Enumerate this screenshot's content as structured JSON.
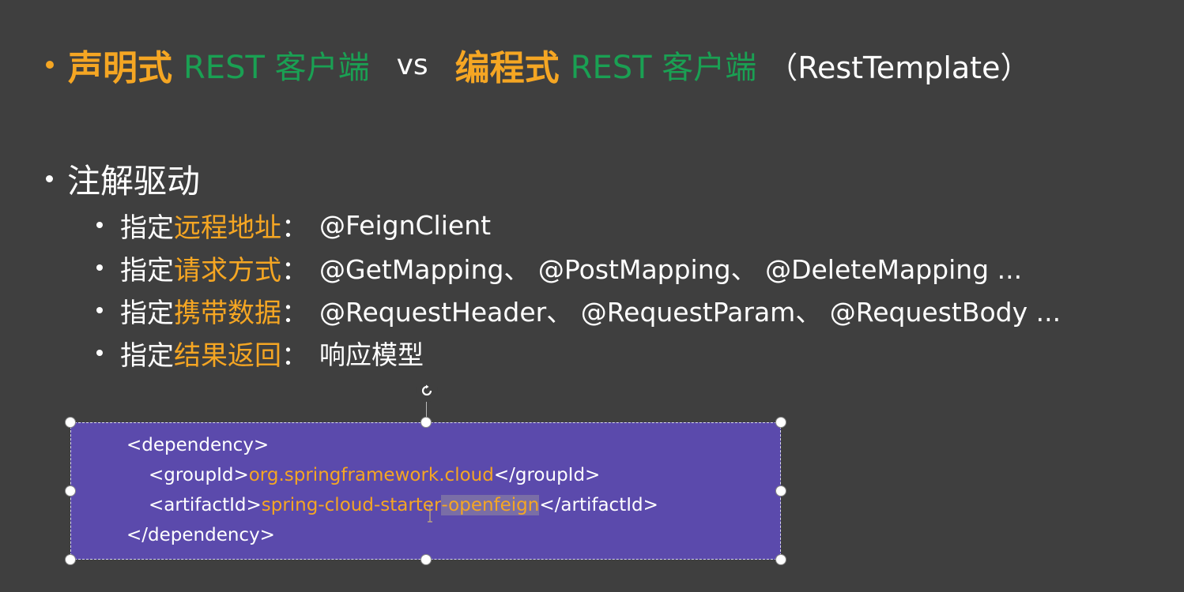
{
  "title": {
    "part1": "声明式",
    "part2": "REST 客户端",
    "vs": "vs",
    "part3": "编程式",
    "part4": "REST 客户端",
    "part5": "（RestTemplate）"
  },
  "section": {
    "heading": "注解驱动",
    "items": [
      {
        "prefix": "指定",
        "highlight": "远程地址",
        "colon": "：",
        "detail": "@FeignClient"
      },
      {
        "prefix": "指定",
        "highlight": "请求方式",
        "colon": "：",
        "detail": "@GetMapping、 @PostMapping、 @DeleteMapping ..."
      },
      {
        "prefix": "指定",
        "highlight": "携带数据",
        "colon": "：",
        "detail": "@RequestHeader、 @RequestParam、 @RequestBody ..."
      },
      {
        "prefix": "指定",
        "highlight": "结果返回",
        "colon": "：",
        "detail": "响应模型"
      }
    ]
  },
  "code": {
    "line1": "<dependency>",
    "line2_open": "<groupId>",
    "line2_value": "org.springframework.cloud",
    "line2_close": "</groupId>",
    "line3_open": "<artifactId>",
    "line3_value_a": "spring-cloud-starter",
    "line3_value_sel": "-openfeign",
    "line3_close": "</artifactId>",
    "line4": "</dependency>"
  },
  "colors": {
    "background": "#3f3f3f",
    "orange": "#f5a623",
    "green": "#1aa053",
    "code_box": "#5b4aac"
  },
  "icons": {
    "rotate": "rotate-icon"
  }
}
